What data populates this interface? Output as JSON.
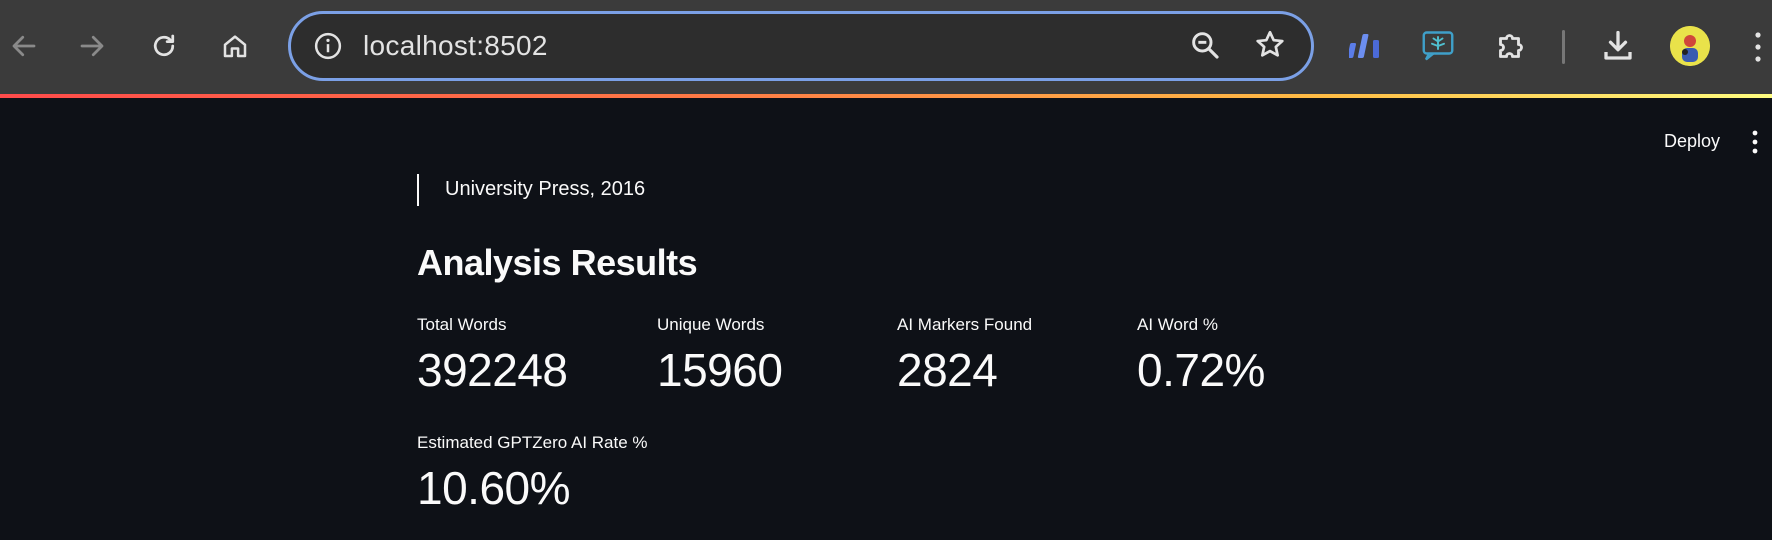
{
  "browser": {
    "url": "localhost:8502",
    "icons": {
      "back": "arrow-left-icon",
      "forward": "arrow-right-icon",
      "reload": "reload-icon",
      "home": "home-icon",
      "site_info": "info-icon",
      "zoom": "zoom-out-icon",
      "bookmark": "star-icon",
      "extensions": [
        "bar-chart-extension-icon",
        "chat-tree-extension-icon",
        "puzzle-extension-icon"
      ],
      "download": "download-icon",
      "menu": "kebab-menu-icon"
    },
    "accent": "#7ba0e6"
  },
  "app_header": {
    "deploy_label": "Deploy"
  },
  "main": {
    "quote_text": "University Press, 2016",
    "heading": "Analysis Results",
    "metrics": [
      {
        "label": "Total Words",
        "value": "392248"
      },
      {
        "label": "Unique Words",
        "value": "15960"
      },
      {
        "label": "AI Markers Found",
        "value": "2824"
      },
      {
        "label": "AI Word %",
        "value": "0.72%"
      },
      {
        "label": "Estimated GPTZero AI Rate %",
        "value": "10.60%"
      }
    ]
  },
  "colors": {
    "background": "#0e1117",
    "text": "#fafafa",
    "browser_bar": "#3b3b3b"
  }
}
